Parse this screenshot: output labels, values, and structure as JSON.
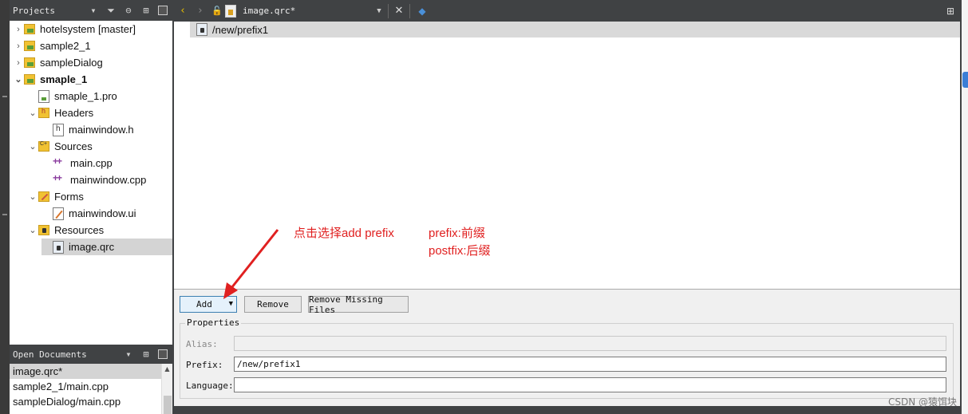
{
  "projects_pane": {
    "title": "Projects",
    "tree": [
      {
        "label": "hotelsystem [master]",
        "icon": "qt-folder-icon",
        "arrow": "›",
        "bold": false
      },
      {
        "label": "sample2_1",
        "icon": "qt-folder-icon",
        "arrow": "›",
        "bold": false
      },
      {
        "label": "sampleDialog",
        "icon": "qt-folder-icon",
        "arrow": "›",
        "bold": false
      },
      {
        "label": "smaple_1",
        "icon": "qt-folder-icon",
        "arrow": "⌄",
        "bold": true
      },
      {
        "label": "smaple_1.pro",
        "icon": "pro-file-icon",
        "arrow": "",
        "bold": false
      },
      {
        "label": "Headers",
        "icon": "headers-folder-icon",
        "arrow": "⌄",
        "bold": false
      },
      {
        "label": "mainwindow.h",
        "icon": "header-file-icon",
        "arrow": "",
        "bold": false
      },
      {
        "label": "Sources",
        "icon": "sources-folder-icon",
        "arrow": "⌄",
        "bold": false
      },
      {
        "label": "main.cpp",
        "icon": "cpp-file-icon",
        "arrow": "",
        "bold": false
      },
      {
        "label": "mainwindow.cpp",
        "icon": "cpp-file-icon",
        "arrow": "",
        "bold": false
      },
      {
        "label": "Forms",
        "icon": "forms-folder-icon",
        "arrow": "⌄",
        "bold": false
      },
      {
        "label": "mainwindow.ui",
        "icon": "ui-file-icon",
        "arrow": "",
        "bold": false
      },
      {
        "label": "Resources",
        "icon": "resources-folder-icon",
        "arrow": "⌄",
        "bold": false
      },
      {
        "label": "image.qrc",
        "icon": "qrc-file-icon",
        "arrow": "",
        "bold": false,
        "selected": true
      }
    ]
  },
  "open_documents": {
    "title": "Open Documents",
    "items": [
      {
        "label": "image.qrc*",
        "selected": true
      },
      {
        "label": "sample2_1/main.cpp",
        "selected": false
      },
      {
        "label": "sampleDialog/main.cpp",
        "selected": false
      }
    ]
  },
  "editor_toolbar": {
    "file_name": "image.qrc*"
  },
  "resource_tree": {
    "prefix_item": "/new/prefix1"
  },
  "buttons": {
    "add": "Add",
    "remove": "Remove",
    "remove_missing": "Remove Missing Files"
  },
  "properties": {
    "title": "Properties",
    "alias_label": "Alias:",
    "alias_value": "",
    "prefix_label": "Prefix:",
    "prefix_value": "/new/prefix1",
    "language_label": "Language:",
    "language_value": ""
  },
  "annotations": {
    "instruction": "点击选择add prefix",
    "prefix_note": "prefix:前缀",
    "postfix_note": "postfix:后缀",
    "color": "#e02020"
  },
  "watermark": "CSDN @猿饵块"
}
